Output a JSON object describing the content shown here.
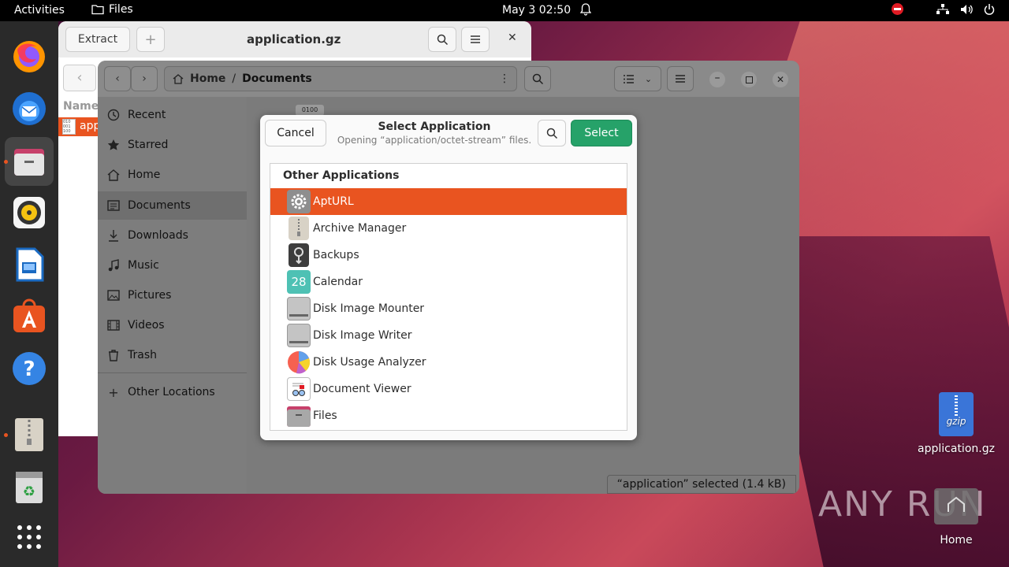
{
  "topbar": {
    "activities": "Activities",
    "app_name": "Files",
    "clock": "May 3  02:50"
  },
  "archive_window": {
    "extract_label": "Extract",
    "title": "application.gz",
    "column_name": "Name",
    "file_partial": "app"
  },
  "files_window": {
    "breadcrumb_home": "Home",
    "breadcrumb_current": "Documents",
    "sidebar": [
      {
        "label": "Recent",
        "icon": "clock-icon"
      },
      {
        "label": "Starred",
        "icon": "star-icon"
      },
      {
        "label": "Home",
        "icon": "home-icon"
      },
      {
        "label": "Documents",
        "icon": "document-icon"
      },
      {
        "label": "Downloads",
        "icon": "download-icon"
      },
      {
        "label": "Music",
        "icon": "music-icon"
      },
      {
        "label": "Pictures",
        "icon": "picture-icon"
      },
      {
        "label": "Videos",
        "icon": "video-icon"
      },
      {
        "label": "Trash",
        "icon": "trash-icon"
      }
    ],
    "other_locations": "Other Locations",
    "thumb_label": "0100",
    "status": "“application” selected  (1.4 kB)"
  },
  "dialog": {
    "cancel_label": "Cancel",
    "title": "Select Application",
    "subtitle": "Opening “application/octet-stream” files.",
    "select_label": "Select",
    "section_header": "Other Applications",
    "apps": [
      {
        "label": "AptURL",
        "icon": "gear-icon",
        "selected": true
      },
      {
        "label": "Archive Manager",
        "icon": "archive-icon"
      },
      {
        "label": "Backups",
        "icon": "backups-icon"
      },
      {
        "label": "Calendar",
        "icon": "calendar-icon",
        "text": "28"
      },
      {
        "label": "Disk Image Mounter",
        "icon": "disk-icon"
      },
      {
        "label": "Disk Image Writer",
        "icon": "disk-icon"
      },
      {
        "label": "Disk Usage Analyzer",
        "icon": "pie-icon"
      },
      {
        "label": "Document Viewer",
        "icon": "document-viewer-icon"
      },
      {
        "label": "Files",
        "icon": "folder-icon"
      }
    ]
  },
  "desktop": {
    "archive_label": "application.gz",
    "archive_icon_text": "gzip",
    "home_label": "Home"
  },
  "watermark": "ANY RUN",
  "colors": {
    "accent": "#e95420",
    "select_button": "#26a269"
  }
}
